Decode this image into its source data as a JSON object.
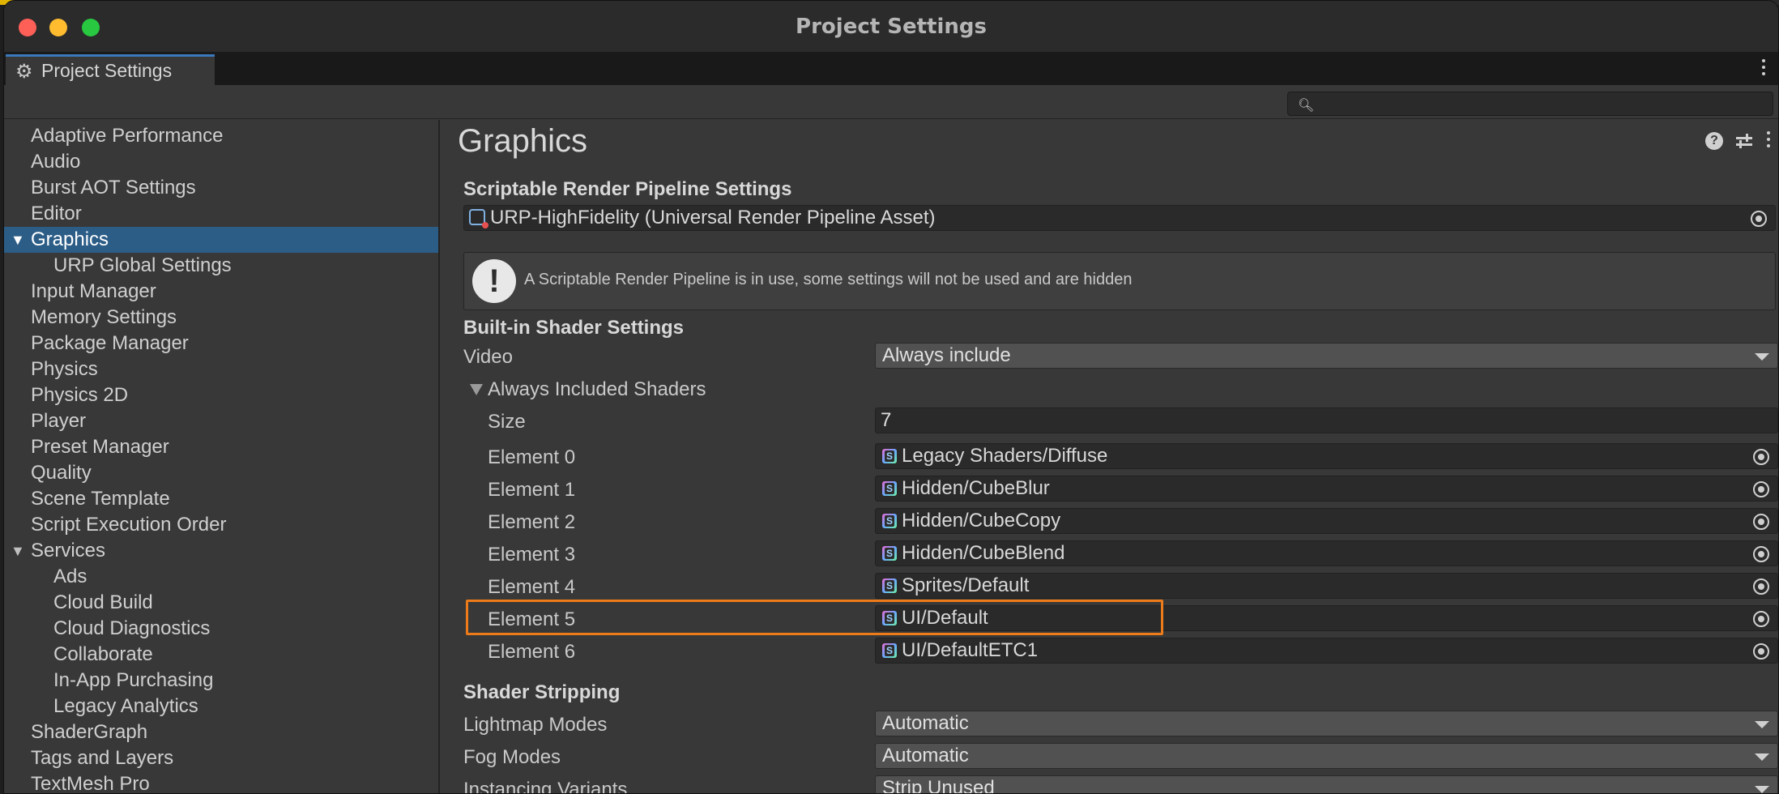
{
  "window": {
    "title": "Project Settings"
  },
  "tab": {
    "label": "Project Settings",
    "icon": "gear-icon"
  },
  "search": {
    "placeholder": ""
  },
  "sidebar": {
    "items": [
      {
        "label": "Adaptive Performance",
        "level": 0
      },
      {
        "label": "Audio",
        "level": 0
      },
      {
        "label": "Burst AOT Settings",
        "level": 0
      },
      {
        "label": "Editor",
        "level": 0
      },
      {
        "label": "Graphics",
        "level": 0,
        "expanded": true,
        "selected": true
      },
      {
        "label": "URP Global Settings",
        "level": 1
      },
      {
        "label": "Input Manager",
        "level": 0
      },
      {
        "label": "Memory Settings",
        "level": 0
      },
      {
        "label": "Package Manager",
        "level": 0
      },
      {
        "label": "Physics",
        "level": 0
      },
      {
        "label": "Physics 2D",
        "level": 0
      },
      {
        "label": "Player",
        "level": 0
      },
      {
        "label": "Preset Manager",
        "level": 0
      },
      {
        "label": "Quality",
        "level": 0
      },
      {
        "label": "Scene Template",
        "level": 0
      },
      {
        "label": "Script Execution Order",
        "level": 0
      },
      {
        "label": "Services",
        "level": 0,
        "expanded": true
      },
      {
        "label": "Ads",
        "level": 1
      },
      {
        "label": "Cloud Build",
        "level": 1
      },
      {
        "label": "Cloud Diagnostics",
        "level": 1
      },
      {
        "label": "Collaborate",
        "level": 1
      },
      {
        "label": "In-App Purchasing",
        "level": 1
      },
      {
        "label": "Legacy Analytics",
        "level": 1
      },
      {
        "label": "ShaderGraph",
        "level": 0
      },
      {
        "label": "Tags and Layers",
        "level": 0
      },
      {
        "label": "TextMesh Pro",
        "level": 0
      }
    ]
  },
  "main": {
    "title": "Graphics",
    "srp": {
      "header": "Scriptable Render Pipeline Settings",
      "asset": "URP-HighFidelity (Universal Render Pipeline Asset)",
      "help": "A Scriptable Render Pipeline is in use, some settings will not be used and are hidden"
    },
    "builtin": {
      "header": "Built-in Shader Settings",
      "video_label": "Video",
      "video_value": "Always include",
      "always_label": "Always Included Shaders",
      "size_label": "Size",
      "size_value": "7",
      "elements": [
        {
          "label": "Element 0",
          "value": "Legacy Shaders/Diffuse"
        },
        {
          "label": "Element 1",
          "value": "Hidden/CubeBlur"
        },
        {
          "label": "Element 2",
          "value": "Hidden/CubeCopy"
        },
        {
          "label": "Element 3",
          "value": "Hidden/CubeBlend"
        },
        {
          "label": "Element 4",
          "value": "Sprites/Default"
        },
        {
          "label": "Element 5",
          "value": "UI/Default"
        },
        {
          "label": "Element 6",
          "value": "UI/DefaultETC1"
        }
      ]
    },
    "stripping": {
      "header": "Shader Stripping",
      "rows": [
        {
          "label": "Lightmap Modes",
          "value": "Automatic"
        },
        {
          "label": "Fog Modes",
          "value": "Automatic"
        },
        {
          "label": "Instancing Variants",
          "value": "Strip Unused"
        }
      ]
    }
  },
  "colors": {
    "accent": "#2c5d87",
    "highlight": "#ee7b19",
    "tab_accent": "#3a79bb"
  }
}
